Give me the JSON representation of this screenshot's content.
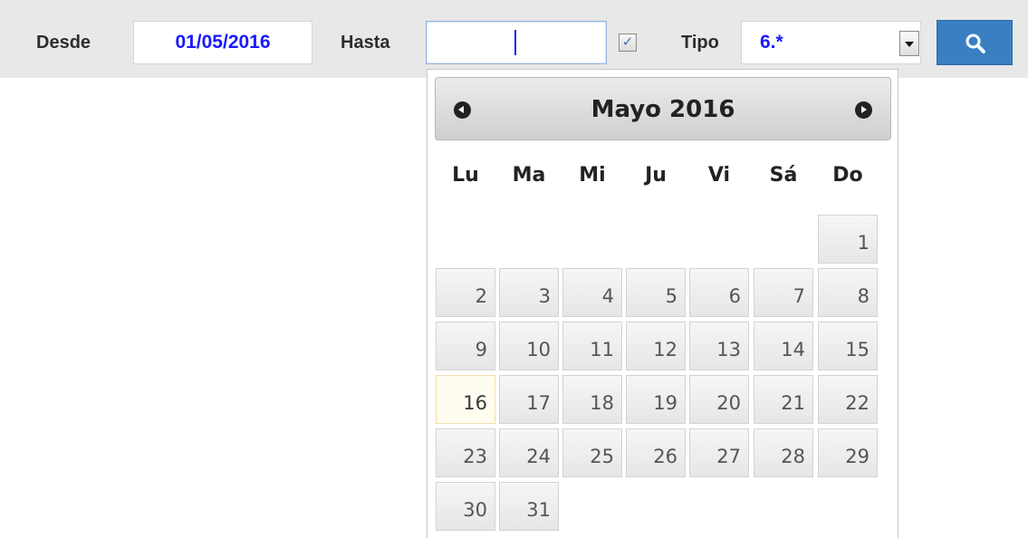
{
  "filter": {
    "desde_label": "Desde",
    "desde_value": "01/05/2016",
    "hasta_label": "Hasta",
    "hasta_value": "",
    "checkbox_checked": true,
    "tipo_label": "Tipo",
    "tipo_value": "6.*"
  },
  "calendar": {
    "month_title": "Mayo 2016",
    "weekdays": [
      "Lu",
      "Ma",
      "Mi",
      "Ju",
      "Vi",
      "Sá",
      "Do"
    ],
    "first_weekday_index": 6,
    "days": [
      "1",
      "2",
      "3",
      "4",
      "5",
      "6",
      "7",
      "8",
      "9",
      "10",
      "11",
      "12",
      "13",
      "14",
      "15",
      "16",
      "17",
      "18",
      "19",
      "20",
      "21",
      "22",
      "23",
      "24",
      "25",
      "26",
      "27",
      "28",
      "29",
      "30",
      "31"
    ],
    "highlighted_day": "16"
  },
  "colors": {
    "value_text": "#1a1aff",
    "search_button": "#3a7fc2",
    "today_bg": "#fffdf0"
  },
  "icons": {
    "search": "search-icon",
    "prev": "prev-month-icon",
    "next": "next-month-icon",
    "dropdown": "chevron-down-icon",
    "checkbox": "check-icon"
  }
}
